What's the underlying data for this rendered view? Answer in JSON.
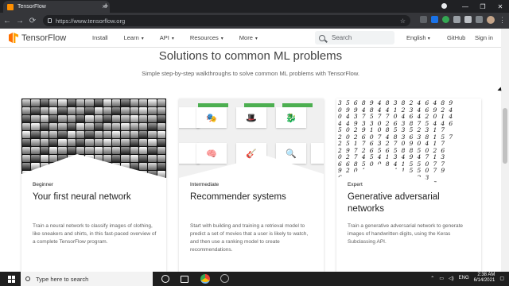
{
  "browser": {
    "tab_title": "TensorFlow",
    "tab_close": "×",
    "new_tab": "+",
    "url": "https://www.tensorflow.org",
    "window_min": "—",
    "window_max": "❐",
    "window_close": "✕",
    "back": "←",
    "forward": "→",
    "reload": "⟳",
    "star": "☆",
    "menu": "⋮"
  },
  "site": {
    "logo_text": "TensorFlow",
    "nav": [
      "Install",
      "Learn",
      "API",
      "Resources",
      "More"
    ],
    "search_placeholder": "Search",
    "language": "English",
    "github": "GitHub",
    "signin": "Sign in"
  },
  "hero": {
    "title": "Solutions to common ML problems",
    "subtitle": "Simple step-by-step walkthroughs to solve common ML problems with TensorFlow."
  },
  "cards": [
    {
      "level": "Beginner",
      "title": "Your first neural network",
      "description": "Train a neural network to classify images of clothing, like sneakers and shirts, in this fast-paced overview of a complete TensorFlow program."
    },
    {
      "level": "Intermediate",
      "title": "Recommender systems",
      "description": "Start with building and training a retrieval model to predict a set of movies that a user is likely to watch, and then use a ranking model to create recommendations."
    },
    {
      "level": "Expert",
      "title": "Generative adversarial networks",
      "description": "Train a generative adversarial network to generate images of handwritten digits, using the Keras Subclassing API."
    }
  ],
  "digits_text": "3 5 6 8 9 4 8 3 8 2 4 6 4 8 9\n0 9 9 4 8 4 4 1 2 3 4 6 9 2 4\n0 4 3 7 5 7 7 0 4 6 4 2 0 1 4\n4 4 9 3 3 0 2 6 3 8 7 5 4 4 6\n5 0 2 9 1 0 8 5 3 5 2 3 1 7\n2 0 2 6 0 7 4 8 3 6 3 8 1 5 7\n2 5 1 7 6 3 2 7 0 9 0 4 1 7\n2 9 7 2 6 5 6 5 8 8 5 0 2 6\n0 2 7 4 5 4 1 3 4 9 4 7 1 3\n6 6 8 5 0 0 8 4 1 5 5 0 7 7\n9 2 0 1 3 3 8 4 1 5 5 0 7 9\n6 1 9 4 7 8 4 1 8 9 2 3\n6 1 9 4 8 8 7 4 2 6 1 3 5",
  "taskbar": {
    "search_text": "Type here to search",
    "language": "ENG",
    "time": "2:38 AM",
    "date": "6/14/2021"
  }
}
